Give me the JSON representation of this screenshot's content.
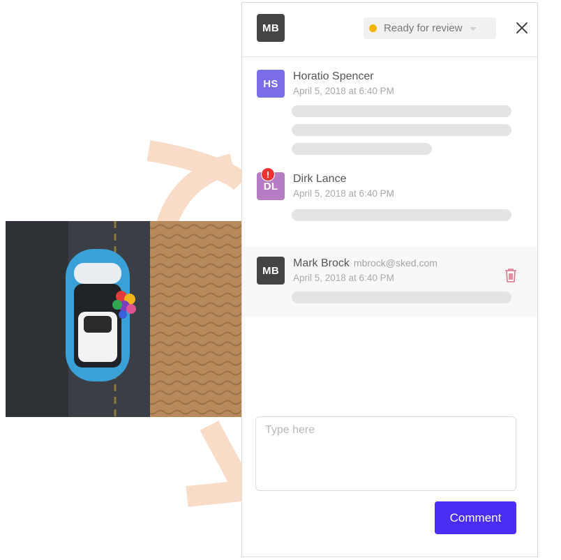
{
  "header": {
    "user_initials": "MB",
    "status_label": "Ready for review"
  },
  "comments": [
    {
      "initials": "HS",
      "name": "Horatio Spencer",
      "date": "April 5, 2018 at 6:40 PM"
    },
    {
      "initials": "DL",
      "name": "Dirk Lance",
      "date": "April 5, 2018 at 6:40 PM",
      "alert": "!"
    },
    {
      "initials": "MB",
      "name": "Mark Brock",
      "email": "mbrock@sked.com",
      "date": "April 5, 2018 at 6:40 PM"
    }
  ],
  "composer": {
    "placeholder": "Type here",
    "submit_label": "Comment"
  },
  "colors": {
    "accent": "#4a2ef5",
    "status_dot": "#f4b400",
    "alert": "#ef3333",
    "decoration": "#f7d9c4"
  }
}
